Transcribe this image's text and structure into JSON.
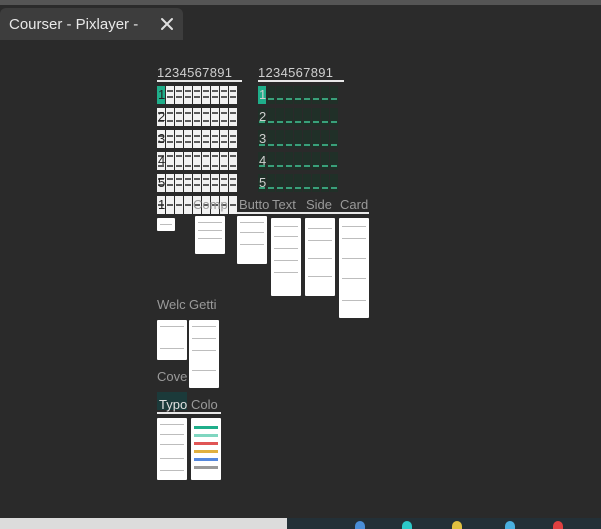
{
  "tab": {
    "title": "Courser - Pixlayer -"
  },
  "icons": {
    "close": "close-icon"
  },
  "canvas": {
    "grid_left_header": "1234567891",
    "grid_right_header": "1234567891",
    "grid_rows": [
      {
        "left": "1",
        "right": "1"
      },
      {
        "left": "2",
        "right": "2"
      },
      {
        "left": "3",
        "right": "3"
      },
      {
        "left": "4",
        "right": "4"
      },
      {
        "left": "5",
        "right": "5"
      },
      {
        "left": "1",
        "right": ""
      }
    ],
    "row_labels": [
      "Comp",
      "Butto",
      "Text",
      "Side",
      "Card"
    ],
    "section_welcome": "Welc",
    "section_getting": "Getti",
    "section_cover": "Cove",
    "section_typo": "Typo",
    "section_color": "Colo"
  },
  "colors": {
    "accent": "#1fae8a",
    "canvas": "#2a2a2a",
    "tab": "#3d3d3d"
  }
}
